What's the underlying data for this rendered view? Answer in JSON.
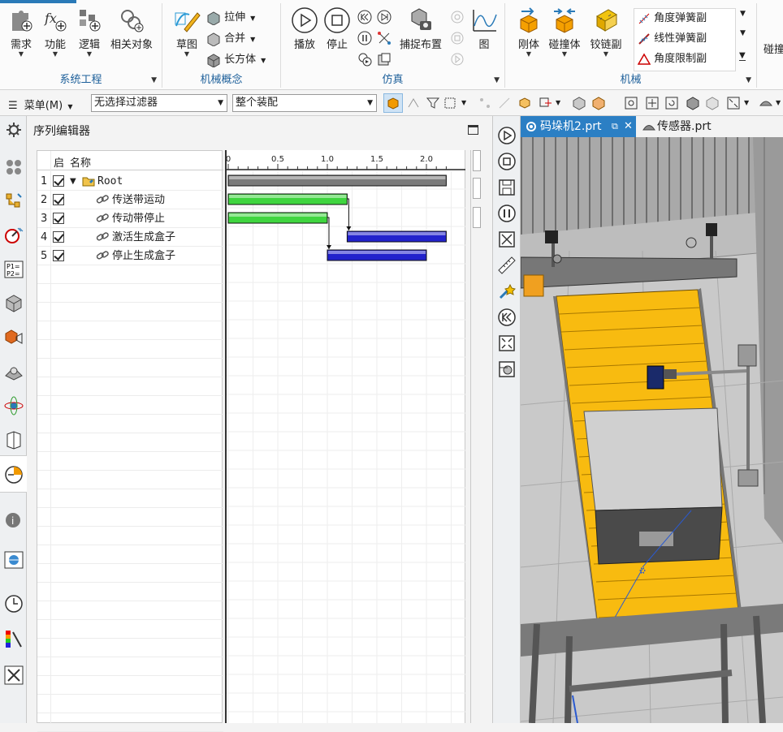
{
  "ribbon": {
    "groups": [
      {
        "label": "系统工程"
      },
      {
        "label": "机械概念"
      },
      {
        "label": "仿真"
      },
      {
        "label": "机械"
      }
    ],
    "sys": {
      "need": "需求",
      "func": "功能",
      "logic": "逻辑",
      "related": "相关对象"
    },
    "mech_concept": {
      "sketch": "草图",
      "extrude": "拉伸",
      "unite": "合并",
      "block": "长方体"
    },
    "sim": {
      "play": "播放",
      "stop": "停止",
      "capture": "捕捉布置",
      "graph": "图"
    },
    "mech": {
      "rigid": "刚体",
      "collision": "碰撞体",
      "hinge": "铰链副",
      "angular_spring": "角度弹簧副",
      "linear_spring": "线性弹簧副",
      "angle_limit": "角度限制副",
      "cut_label": "碰撞"
    }
  },
  "toolbar": {
    "menu": "菜单(M)",
    "filter": "无选择过滤器",
    "scope": "整个装配"
  },
  "sequence_editor": {
    "title": "序列编辑器",
    "columns": {
      "enable": "启",
      "name": "名称"
    },
    "rows": [
      {
        "num": "1",
        "name": "Root"
      },
      {
        "num": "2",
        "name": "传送带运动"
      },
      {
        "num": "3",
        "name": "传动带停止"
      },
      {
        "num": "4",
        "name": "激活生成盒子"
      },
      {
        "num": "5",
        "name": "停止生成盒子"
      }
    ],
    "timeline": {
      "ticks": [
        "0",
        "0.5",
        "1.0",
        "1.5",
        "2.0"
      ],
      "bars": [
        {
          "row": 1,
          "start": 0.0,
          "end": 2.2,
          "color": "#7a7a7a"
        },
        {
          "row": 2,
          "start": 0.0,
          "end": 1.2,
          "color": "#3fd53f"
        },
        {
          "row": 3,
          "start": 0.0,
          "end": 1.0,
          "color": "#3fd53f"
        },
        {
          "row": 4,
          "start": 1.2,
          "end": 2.2,
          "color": "#2222cc"
        },
        {
          "row": 5,
          "start": 1.0,
          "end": 2.0,
          "color": "#2222cc"
        }
      ]
    }
  },
  "tabs": [
    {
      "label": "码垛机2.prt",
      "active": true
    },
    {
      "label": "传感器.prt",
      "active": false
    }
  ],
  "colors": {
    "accent": "#2a7ab8",
    "tab_active": "#2b7fc4",
    "conveyor": "#f8bb10"
  }
}
